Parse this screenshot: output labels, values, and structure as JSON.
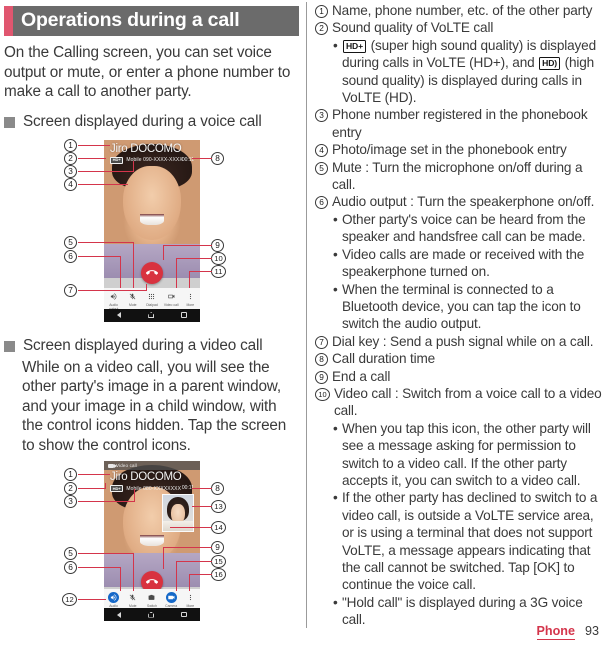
{
  "heading": {
    "title": "Operations during a call"
  },
  "intro": "On the Calling screen, you can set voice output or mute, or enter a phone number to make a call to another party.",
  "sections": [
    {
      "title": "Screen displayed during a voice call",
      "body": ""
    },
    {
      "title": "Screen displayed during a video call",
      "body": "While on a video call, you will see the other party's image in a parent window, and your image in a child window, with the control icons hidden. Tap the screen to show the control icons."
    }
  ],
  "voice_call_screen": {
    "caller_name": "Jiro DOCOMO",
    "hd_badge": "HD+",
    "phone_number": "Mobile 090-XXXX-XXXX",
    "call_time": "00:11",
    "controls": [
      {
        "label": "Audio output",
        "icon": "speaker-icon",
        "active": false
      },
      {
        "label": "Mute",
        "icon": "microphone-off-icon",
        "active": false
      },
      {
        "label": "Dialpad",
        "icon": "dialpad-icon",
        "active": false
      },
      {
        "label": "Video call",
        "icon": "video-camera-icon",
        "active": false
      },
      {
        "label": "More",
        "icon": "more-vertical-icon",
        "active": false
      }
    ],
    "end_call_icon": "end-call-icon",
    "callouts_left": [
      "1",
      "2",
      "3",
      "4",
      "5",
      "6",
      "7"
    ],
    "callouts_right": [
      "8",
      "9",
      "10",
      "11"
    ]
  },
  "video_call_screen": {
    "title_bar": "Video call",
    "title_bar_icon": "video-camera-icon",
    "caller_name": "Jiro DOCOMO",
    "hd_badge": "HD+",
    "phone_number": "Mobile 080-XXXXXXXX",
    "call_time": "00:11",
    "controls": [
      {
        "label": "Audio output",
        "icon": "speaker-icon",
        "active": true
      },
      {
        "label": "Mute",
        "icon": "microphone-off-icon",
        "active": false
      },
      {
        "label": "Switch camera",
        "icon": "switch-camera-icon",
        "active": false
      },
      {
        "label": "Camera",
        "icon": "video-camera-icon",
        "active": true
      },
      {
        "label": "More",
        "icon": "more-vertical-icon",
        "active": false
      }
    ],
    "end_call_icon": "end-call-icon",
    "callouts_left": [
      "1",
      "2",
      "3",
      "5",
      "6",
      "12"
    ],
    "callouts_right": [
      "8",
      "13",
      "14",
      "9",
      "15",
      "16"
    ]
  },
  "legend": [
    {
      "num": "1",
      "text": "Name, phone number, etc. of the other party",
      "subs": []
    },
    {
      "num": "2",
      "text": "Sound quality of VoLTE call",
      "subs": [
        {
          "pre": "",
          "tag1": "HD+",
          "mid": " (super high sound quality) is displayed during calls in VoLTE (HD+), and ",
          "tag2": "HD)",
          "post": " (high sound quality) is displayed during calls in VoLTE (HD)."
        }
      ]
    },
    {
      "num": "3",
      "text": "Phone number registered in the phonebook entry",
      "subs": []
    },
    {
      "num": "4",
      "text": "Photo/image set in the phonebook entry",
      "subs": []
    },
    {
      "num": "5",
      "text": "Mute : Turn the microphone on/off during a call.",
      "subs": []
    },
    {
      "num": "6",
      "text": "Audio output : Turn the speakerphone on/off.",
      "subs": [
        {
          "pre": "Other party's voice can be heard from the speaker and handsfree call can be made."
        },
        {
          "pre": "Video calls are made or received with the speakerphone turned on."
        },
        {
          "pre": "When the terminal is connected to a Bluetooth device, you can tap the icon to switch the audio output."
        }
      ]
    },
    {
      "num": "7",
      "text": "Dial key : Send a push signal while on a call.",
      "subs": []
    },
    {
      "num": "8",
      "text": "Call duration time",
      "subs": []
    },
    {
      "num": "9",
      "text": "End a call",
      "subs": []
    },
    {
      "num": "10",
      "text": "Video call : Switch from a voice call to a video call.",
      "subs": [
        {
          "pre": "When you tap this icon, the other party will see a message asking for permission to switch to a video call. If the other party accepts it, you can switch to a video call."
        },
        {
          "pre": "If the other party has declined to switch to a video call, is outside a VoLTE service area, or is using a terminal that does not support VoLTE, a message appears indicating that the call cannot be switched. Tap [OK] to continue the voice call."
        },
        {
          "pre": "\"Hold call\" is displayed during a 3G voice call."
        }
      ]
    }
  ],
  "footer": {
    "section": "Phone",
    "page": "93"
  }
}
